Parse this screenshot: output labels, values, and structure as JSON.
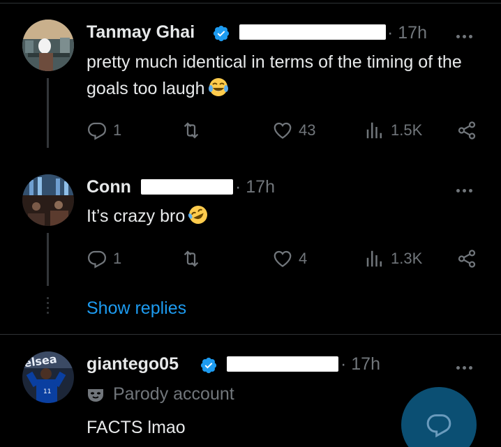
{
  "tweets": [
    {
      "author": "Tanmay Ghai",
      "verified": true,
      "time": "· 17h",
      "text": "pretty much identical in terms of the timing of the goals too laugh",
      "emoji": "😂",
      "replies": "1",
      "reposts": "",
      "likes": "43",
      "views": "1.5K"
    },
    {
      "author": "Conn",
      "verified": false,
      "time": "· 17h",
      "text": "It’s crazy bro",
      "emoji": "🤣",
      "replies": "1",
      "reposts": "",
      "likes": "4",
      "views": "1.3K"
    },
    {
      "author": "giantego05",
      "verified": true,
      "time": "· 17h",
      "label": "Parody account",
      "text": "FACTS lmao"
    }
  ],
  "show_replies": "Show replies",
  "colors": {
    "background": "#000000",
    "text": "#e7e9ea",
    "muted": "#71767b",
    "accent": "#1d9bf0",
    "divider": "#2f3336"
  },
  "icons": {
    "reply": "reply-icon",
    "repost": "repost-icon",
    "like": "heart-icon",
    "views": "views-icon",
    "share": "share-icon",
    "more": "more-icon",
    "verified": "verified-badge-icon",
    "parody": "mask-icon",
    "compose": "compose-reply-icon"
  }
}
